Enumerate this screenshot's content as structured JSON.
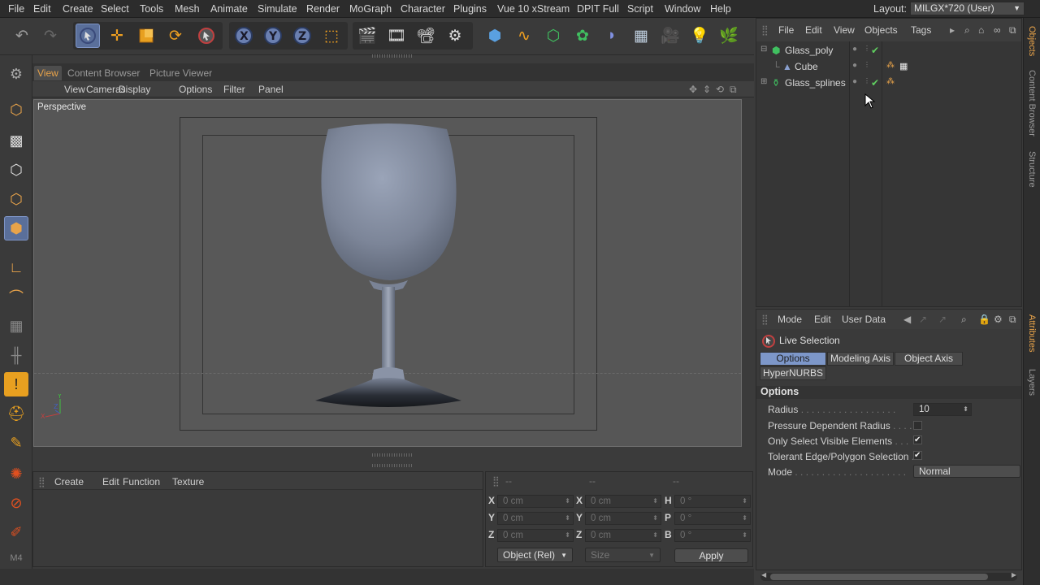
{
  "menubar": {
    "items": [
      "File",
      "Edit",
      "Create",
      "Select",
      "Tools",
      "Mesh",
      "Animate",
      "Simulate",
      "Render",
      "MoGraph",
      "Character",
      "Plugins",
      "Vue 10 xStream",
      "DPIT Full",
      "Script",
      "Window",
      "Help"
    ],
    "layout_label": "Layout:",
    "layout_value": "MILGX*720 (User)"
  },
  "viewport": {
    "tabs": [
      "View",
      "Content Browser",
      "Picture Viewer"
    ],
    "menu": [
      "View",
      "Cameras",
      "Display",
      "Options",
      "Filter",
      "Panel"
    ],
    "camera_label": "Perspective"
  },
  "bottom_panel": {
    "menu": [
      "Create",
      "Edit",
      "Function",
      "Texture"
    ]
  },
  "coordinates": {
    "headers": [
      "--",
      "--",
      "--"
    ],
    "rows": [
      {
        "a_label": "X",
        "a_value": "0 cm",
        "b_label": "X",
        "b_value": "0 cm",
        "c_label": "H",
        "c_value": "0 °"
      },
      {
        "a_label": "Y",
        "a_value": "0 cm",
        "b_label": "Y",
        "b_value": "0 cm",
        "c_label": "P",
        "c_value": "0 °"
      },
      {
        "a_label": "Z",
        "a_value": "0 cm",
        "b_label": "Z",
        "b_value": "0 cm",
        "c_label": "B",
        "c_value": "0 °"
      }
    ],
    "mode_select": "Object (Rel)",
    "size_select": "Size",
    "apply_label": "Apply"
  },
  "objects_panel": {
    "menu": [
      "File",
      "Edit",
      "View",
      "Objects",
      "Tags"
    ],
    "items": [
      {
        "name": "Glass_poly"
      },
      {
        "name": "Cube"
      },
      {
        "name": "Glass_splines"
      }
    ]
  },
  "attributes_panel": {
    "menu": [
      "Mode",
      "Edit",
      "User Data"
    ],
    "tool_name": "Live Selection",
    "tabs": [
      "Options",
      "Modeling Axis",
      "Object Axis",
      "HyperNURBS"
    ],
    "section": "Options",
    "radius_label": "Radius",
    "radius_value": "10",
    "pressure_label": "Pressure Dependent Radius",
    "only_visible_label": "Only Select Visible Elements",
    "tolerant_label": "Tolerant Edge/Polygon Selection",
    "mode_label": "Mode",
    "mode_value": "Normal"
  },
  "side_tabs": [
    "Objects",
    "Content Browser",
    "Structure",
    "Attributes",
    "Layers"
  ],
  "colors": {
    "accent_orange": "#e8a34a",
    "selected_blue": "#5a6f9a",
    "tab_blue": "#7d97c9"
  }
}
